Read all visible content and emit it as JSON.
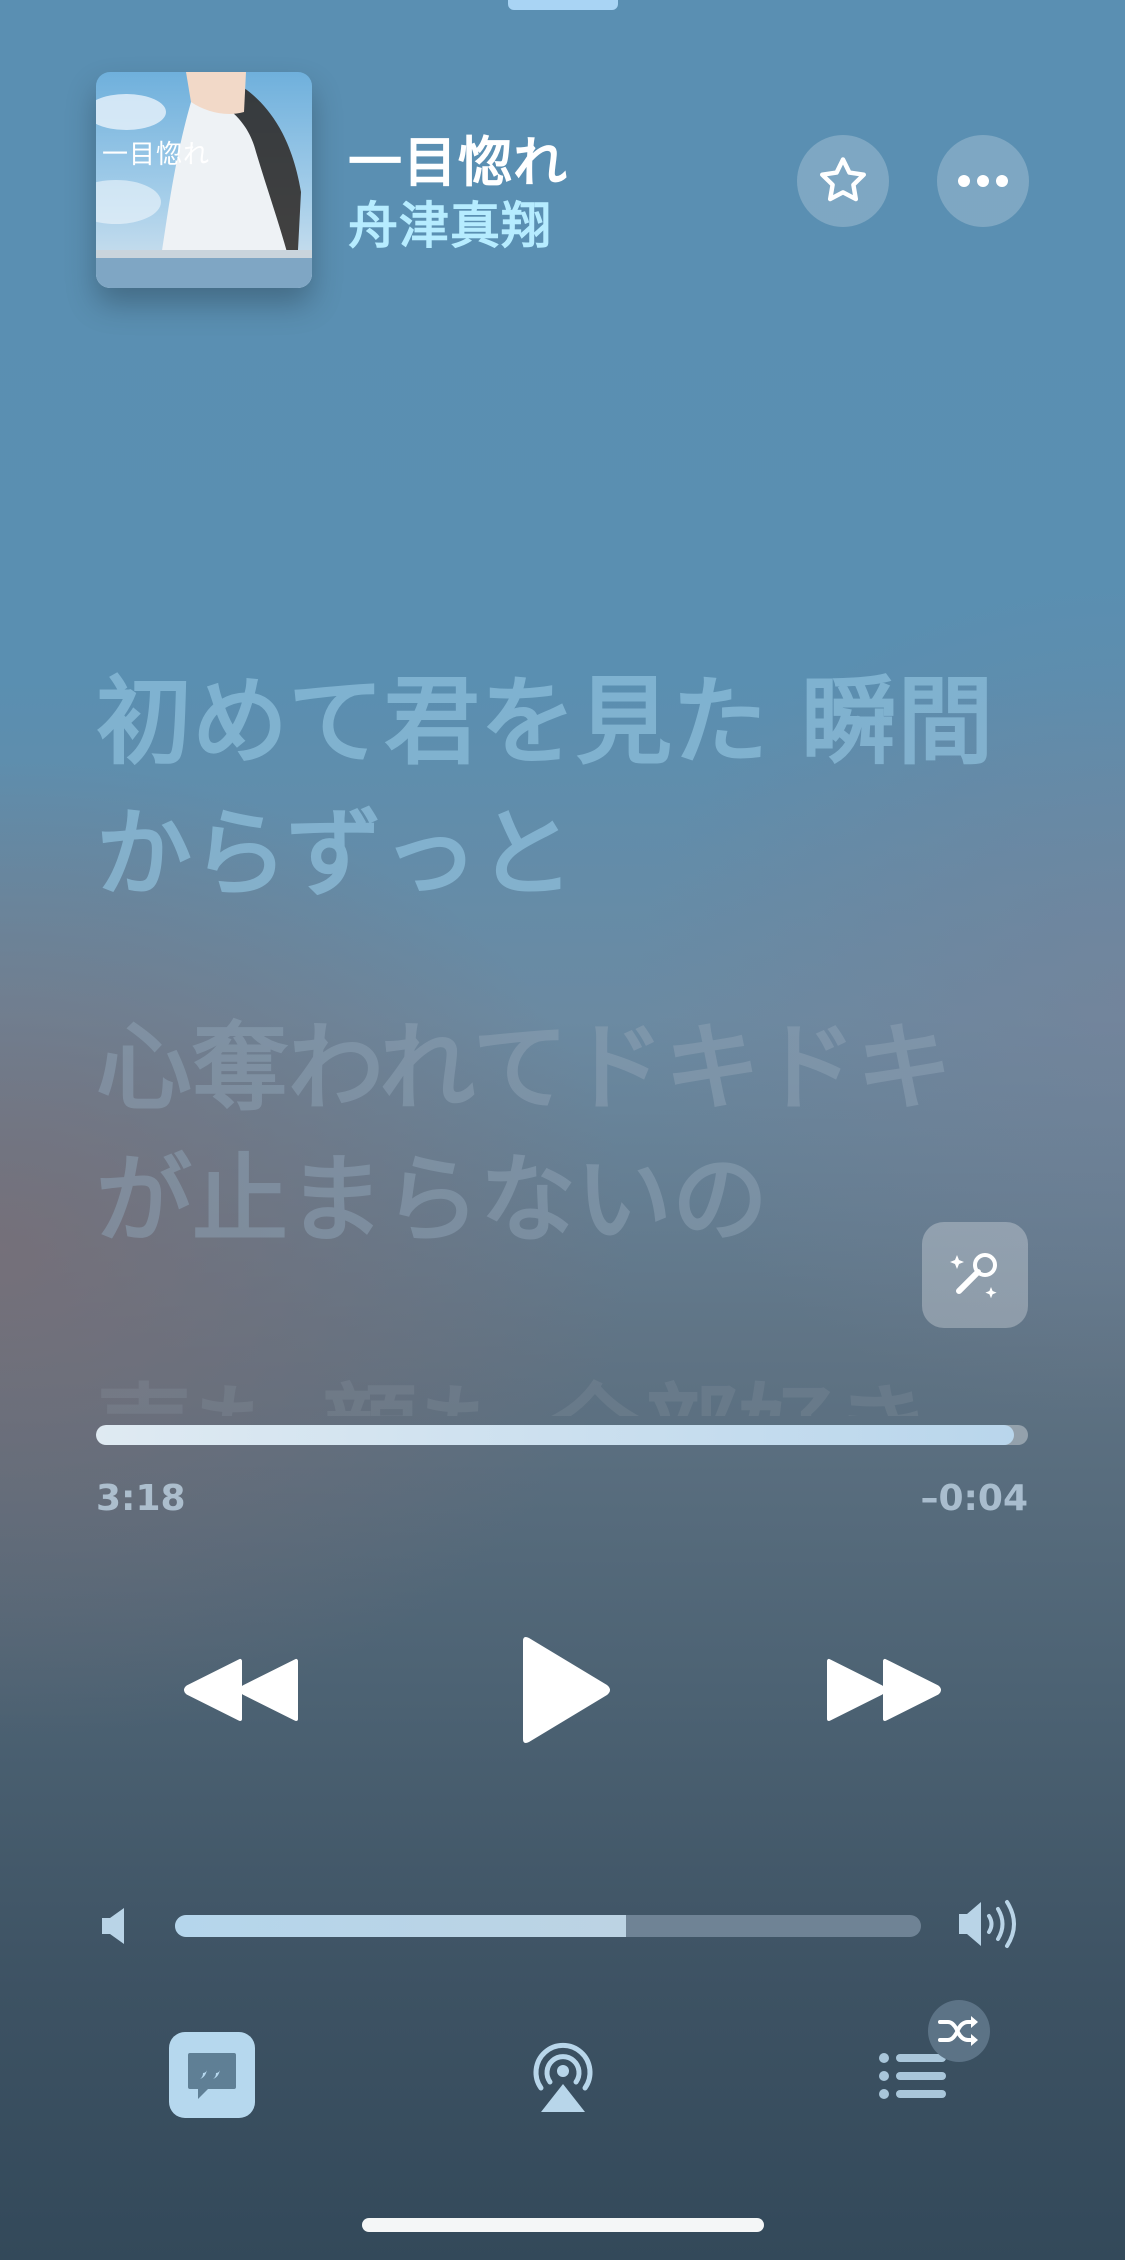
{
  "header": {
    "title": "一目惚れ",
    "artist": "舟津真翔",
    "artwork_text": "一目惚れ",
    "favorite_icon": "star-icon",
    "more_icon": "ellipsis-icon"
  },
  "lyrics": {
    "lines": [
      "初めて君を見た 瞬間からずっと",
      "心奪われてドキドキが止まらないの",
      "声も 顔も 全部好き"
    ],
    "sing_icon": "microphone-sparkles-icon"
  },
  "playback": {
    "elapsed": "3:18",
    "remaining": "–0:04",
    "progress": 0.985
  },
  "transport": {
    "rewind_icon": "rewind-icon",
    "play_icon": "play-icon",
    "forward_icon": "fast-forward-icon"
  },
  "volume": {
    "level": 0.605,
    "low_icon": "speaker-low-icon",
    "high_icon": "speaker-high-icon"
  },
  "bottom_bar": {
    "lyrics_icon": "quote-bubble-icon",
    "airplay_icon": "airplay-audio-icon",
    "queue_icon": "list-icon",
    "shuffle_icon": "shuffle-icon"
  },
  "colors": {
    "artist": "#b6ecff",
    "accent_light": "#b6d8ee"
  }
}
